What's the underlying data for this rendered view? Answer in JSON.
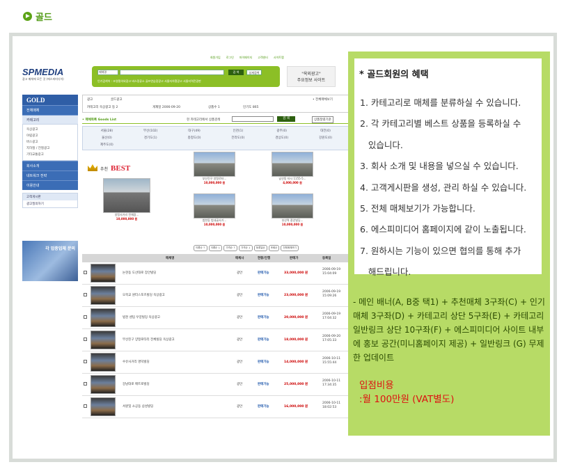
{
  "page": {
    "title": "골드"
  },
  "screenshot": {
    "logo": "SPMEDIA",
    "logo_sub": "광고 매체에 모든 것 (에스피미디어)",
    "top_links": [
      "회원가입",
      "로그인",
      "마이페이지",
      "고객센터",
      "사이트맵"
    ],
    "search": {
      "select": "매체명",
      "button": "검 색",
      "detail_button": "상세검색",
      "keywords": "인기검색어 : 조영필의외광고   버스정류소   골프연습장광고   서울지하철광고   서울지역전광판"
    },
    "top_ad": {
      "line1": "\"옥외광고\"",
      "line2": "주요정보 사이트"
    },
    "left": {
      "gold": "GOLD",
      "nav": [
        "전체매체",
        "카테고리"
      ],
      "subs": [
        "옥상광고",
        "야립광고",
        "버스광고",
        "지하철 / 전철광고",
        "기타교통광고"
      ],
      "nav2": [
        "회사소개",
        "네트워크 전략",
        "이용안내"
      ],
      "cs_title": "고객게시판",
      "cs_item": "광고질의하기",
      "banner": "각 업종업체 문의"
    },
    "info": {
      "category": "광고",
      "name": "골드광고",
      "cat_count": "카테고리 옥상광고 등 2",
      "joined": "게재일  2006-09-20",
      "products": "상품수  1",
      "visits": "인기도  865",
      "home_btn": "• 전체매체보기"
    },
    "list": {
      "title": "• 매체목록 Goods List",
      "search_label": "현 카테고리에서 상품검색",
      "search_btn": "검 색",
      "sort": "상품정렬기준"
    },
    "regions": [
      "서울(28)",
      "부산(102)",
      "대구(49)",
      "인천(1)",
      "광주(0)",
      "대전(0)",
      "울산(0)",
      "경기도(1)",
      "충청도(0)",
      "전라도(0)",
      "경상도(0)",
      "강원도(0)",
      "제주도(0)"
    ],
    "best_label": "추천",
    "best_word": "BEST",
    "best_items": [
      {
        "name": "부산진구 양정로타...",
        "price": "10,000,000 원"
      },
      {
        "name": "남산동 타시 1155-5...",
        "price": "4,000,000 원"
      },
      {
        "name": "양정사거리 전체광...",
        "price": "10,000,000 원"
      },
      {
        "name": "범천동 범내골사거...",
        "price": "10,000,000 원"
      },
      {
        "name": "부산역 중앙빌딩...",
        "price": "10,000,000 원"
      }
    ],
    "filters": [
      "이름순 ↑",
      "이름순 ↓",
      "가격순 ↑",
      "가격순 ↓",
      "등록일순",
      "조회순",
      "전체매체보기"
    ],
    "table_headers": [
      "매체명",
      "매체사",
      "현황/진행",
      "판매가",
      "등록일"
    ],
    "rows": [
      {
        "name": "논현동 도산대로 장안빌딩",
        "company": "광안",
        "status": "판매가능",
        "price": "33,000,000 원",
        "date": "2006-09-19 15:04:09"
      },
      {
        "name": "오목교 원터스포츠빌딩 옥상광고",
        "company": "광안",
        "status": "판매가능",
        "price": "23,000,000 원",
        "date": "2006-09-19 15:09:26"
      },
      {
        "name": "범천 센텀 우양빌딩 옥상광고",
        "company": "광안",
        "status": "판매가능",
        "price": "20,000,000 원",
        "date": "2006-09-19 17:04:32"
      },
      {
        "name": "부산진구 양정로타리 전체빌딩 옥상광고",
        "company": "광안",
        "status": "판매가능",
        "price": "18,000,000 원",
        "date": "2006-09-20 17:05:33"
      },
      {
        "name": "수유사거리 명덕빌딩",
        "company": "광안",
        "status": "판매가능",
        "price": "14,000,000 원",
        "date": "2006-10-11 15:55:44"
      },
      {
        "name": "강남대로 매트로빌딩",
        "company": "광안",
        "status": "판매가능",
        "price": "25,000,000 원",
        "date": "2006-10-11 17:34:35"
      },
      {
        "name": "서원및 소공동 삼성빌딩",
        "company": "광안",
        "status": "판매가능",
        "price": "16,000,000 원",
        "date": "2006-10-11 18:02:53"
      }
    ]
  },
  "benefits": {
    "title": "* 골드회원의 혜택",
    "items": [
      "1. 카테고리로 매체를 분류하실 수 있습니다.",
      "2. 각 카테고리별 베스트 상품을 등록하실 수",
      "   있습니다.",
      "3. 회사 소개 및 내용을 넣으실 수 있습니다.",
      "4. 고객게시판을 생성, 관리 하실 수 있습니다.",
      "5. 전체 매체보기가 가능합니다.",
      "6. 에스피미디어 홈페이지에 같이 노출됩니다.",
      "7. 원하시는 기능이 있으면 협의를 통해 추가",
      "   해드립니다."
    ]
  },
  "description": "- 메인 배너(A, B중 택1) + 추천매체 3구좌(C) + 인기매체 3구좌(D) + 카테고리 상단 5구좌(E) + 카테고리 일반링크 상단 10구좌(F) + 에스피미디어 사이트 내부에 홍보 공간(미니홈페이지 제공) + 일반링크 (G) 무제한 업데이트",
  "pricing": {
    "label": "입점비용",
    "value": ":월 100만원 (VAT별도)"
  },
  "colors": {
    "accent_green": "#5ca316",
    "panel_green": "#b7db66",
    "price_red": "#d11",
    "nav_blue": "#2f5ea6"
  }
}
